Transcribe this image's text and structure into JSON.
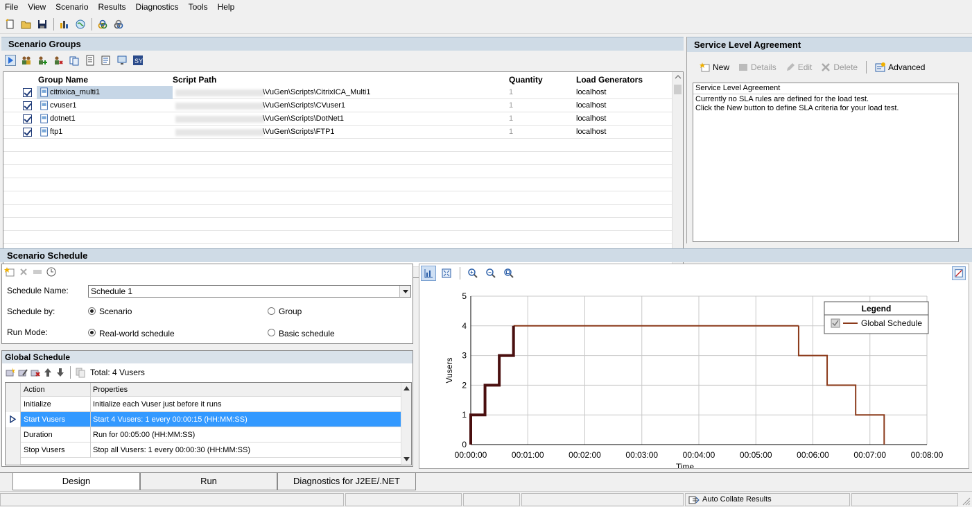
{
  "menu": [
    "File",
    "View",
    "Scenario",
    "Results",
    "Diagnostics",
    "Tools",
    "Help"
  ],
  "colors": {
    "panel_header_bg": "#cfdbe6",
    "selection": "#3399ff",
    "schedule_line": "#8b3a1a",
    "schedule_line_dark": "#4a0f0f"
  },
  "scenario_groups": {
    "title": "Scenario Groups",
    "columns": [
      "Group Name",
      "Script Path",
      "Quantity",
      "Load Generators"
    ],
    "rows": [
      {
        "name": "citrixica_multi1",
        "path": "\\VuGen\\Scripts\\CitrixICA_Multi1",
        "quantity": "1",
        "load_generator": "localhost",
        "checked": true
      },
      {
        "name": "cvuser1",
        "path": "\\VuGen\\Scripts\\CVuser1",
        "quantity": "1",
        "load_generator": "localhost",
        "checked": true
      },
      {
        "name": "dotnet1",
        "path": "\\VuGen\\Scripts\\DotNet1",
        "quantity": "1",
        "load_generator": "localhost",
        "checked": true
      },
      {
        "name": "ftp1",
        "path": "\\VuGen\\Scripts\\FTP1",
        "quantity": "1",
        "load_generator": "localhost",
        "checked": true
      }
    ]
  },
  "sla": {
    "title": "Service Level Agreement",
    "buttons": {
      "new": "New",
      "details": "Details",
      "edit": "Edit",
      "delete": "Delete",
      "advanced": "Advanced"
    },
    "box_title": "Service Level Agreement",
    "line1": "Currently no SLA rules are defined for the load test.",
    "line2": "Click the New button to define SLA criteria for your load test."
  },
  "schedule": {
    "title": "Scenario Schedule",
    "name_label": "Schedule Name:",
    "name_value": "Schedule 1",
    "by_label": "Schedule by:",
    "by_options": [
      "Scenario",
      "Group"
    ],
    "by_selected": "Scenario",
    "mode_label": "Run Mode:",
    "mode_options": [
      "Real-world schedule",
      "Basic schedule"
    ],
    "mode_selected": "Real-world schedule"
  },
  "global_schedule": {
    "title": "Global Schedule",
    "total": "Total: 4 Vusers",
    "columns": [
      "Action",
      "Properties"
    ],
    "rows": [
      {
        "action": "Initialize",
        "properties": "Initialize each Vuser just before it runs"
      },
      {
        "action": "Start  Vusers",
        "properties": "Start 4 Vusers: 1 every 00:00:15 (HH:MM:SS)"
      },
      {
        "action": "Duration",
        "properties": "Run for 00:05:00 (HH:MM:SS)"
      },
      {
        "action": "Stop Vusers",
        "properties": "Stop all Vusers: 1 every 00:00:30 (HH:MM:SS)"
      }
    ],
    "selected_row": 1
  },
  "chart_data": {
    "type": "line",
    "xlabel": "Time",
    "ylabel": "Vusers",
    "x_ticks": [
      "00:00:00",
      "00:01:00",
      "00:02:00",
      "00:03:00",
      "00:04:00",
      "00:05:00",
      "00:06:00",
      "00:07:00",
      "00:08:00"
    ],
    "y_ticks": [
      "0",
      "1",
      "2",
      "3",
      "4",
      "5"
    ],
    "xlim_seconds": [
      0,
      480
    ],
    "ylim": [
      0,
      5
    ],
    "grid": true,
    "legend_title": "Legend",
    "legend_position": "top-right",
    "series": [
      {
        "name": "Global Schedule",
        "ramp_up_points": [
          [
            0,
            0
          ],
          [
            0,
            1
          ],
          [
            15,
            1
          ],
          [
            15,
            2
          ],
          [
            30,
            2
          ],
          [
            30,
            3
          ],
          [
            45,
            3
          ],
          [
            45,
            4
          ]
        ],
        "hold_points": [
          [
            45,
            4
          ],
          [
            345,
            4
          ]
        ],
        "ramp_down_points": [
          [
            345,
            4
          ],
          [
            345,
            3
          ],
          [
            375,
            3
          ],
          [
            375,
            2
          ],
          [
            405,
            2
          ],
          [
            405,
            1
          ],
          [
            435,
            1
          ],
          [
            435,
            0
          ]
        ]
      }
    ]
  },
  "tabs": [
    "Design",
    "Run",
    "Diagnostics for J2EE/.NET"
  ],
  "active_tab": "Design",
  "status": {
    "auto_collate": "Auto Collate Results"
  }
}
